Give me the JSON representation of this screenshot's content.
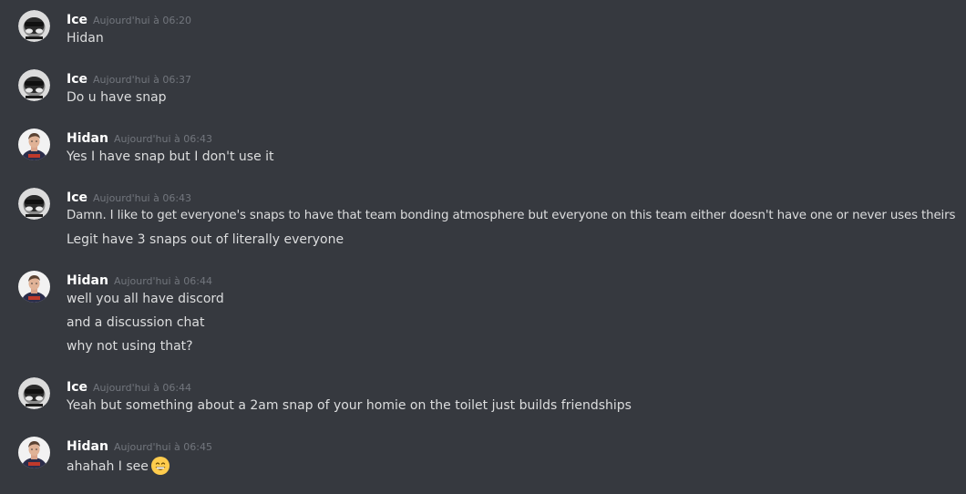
{
  "messages": [
    {
      "author": "Ice",
      "avatar": "helmet-avatar",
      "timestamp": "Aujourd'hui à 06:20",
      "lines": [
        "Hidan"
      ]
    },
    {
      "author": "Ice",
      "avatar": "helmet-avatar",
      "timestamp": "Aujourd'hui à 06:37",
      "lines": [
        "Do u have snap"
      ]
    },
    {
      "author": "Hidan",
      "avatar": "person-avatar",
      "timestamp": "Aujourd'hui à 06:43",
      "lines": [
        "Yes I have snap but I don't use it"
      ]
    },
    {
      "author": "Ice",
      "avatar": "helmet-avatar",
      "timestamp": "Aujourd'hui à 06:43",
      "lines": [
        "Damn. I like to get everyone's snaps to have that team bonding atmosphere but everyone on this team either doesn't have one or never uses theirs",
        "Legit have 3 snaps out of literally everyone"
      ]
    },
    {
      "author": "Hidan",
      "avatar": "person-avatar",
      "timestamp": "Aujourd'hui à 06:44",
      "lines": [
        "well you all have discord",
        "and a discussion chat",
        "why not using that?"
      ]
    },
    {
      "author": "Ice",
      "avatar": "helmet-avatar",
      "timestamp": "Aujourd'hui à 06:44",
      "lines": [
        "Yeah but something about a 2am snap of your homie on the toilet just builds friendships"
      ]
    },
    {
      "author": "Hidan",
      "avatar": "person-avatar",
      "timestamp": "Aujourd'hui à 06:45",
      "lines": [
        "ahahah I see"
      ],
      "emoji": "grinning-smile-emoji"
    }
  ],
  "colors": {
    "background": "#36393f",
    "username": "#ffffff",
    "timestamp": "#72767d",
    "message_text": "#dcddde"
  }
}
